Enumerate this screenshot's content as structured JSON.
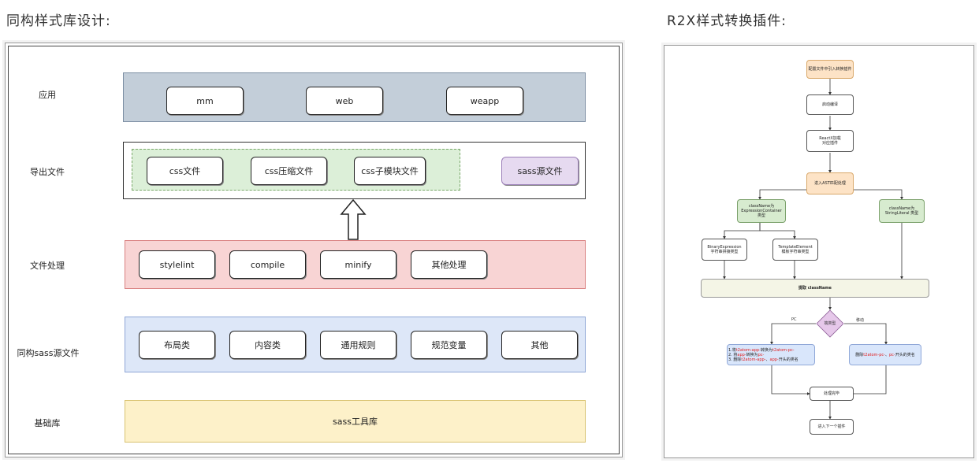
{
  "left": {
    "title": "同构样式库设计:",
    "rows": [
      {
        "label": "应用"
      },
      {
        "label": "导出文件"
      },
      {
        "label": "文件处理"
      },
      {
        "label": "同构sass源文件"
      },
      {
        "label": "基础库"
      }
    ],
    "app_items": [
      "mm",
      "web",
      "weapp"
    ],
    "export_items": [
      "css文件",
      "css压缩文件",
      "css子模块文件"
    ],
    "export_extra": "sass源文件",
    "process_items": [
      "stylelint",
      "compile",
      "minify",
      "其他处理"
    ],
    "source_items": [
      "布局类",
      "内容类",
      "通用规则",
      "规范变量",
      "其他"
    ],
    "base_item": "sass工具库",
    "colors": {
      "app": "#c3ced9",
      "export_group": "#dcefd8",
      "process": "#f8d4d4",
      "source": "#dde7f8",
      "base": "#fdf1c9",
      "sass": "#e6daf0"
    }
  },
  "right": {
    "title": "R2X样式转换插件:",
    "nodes": {
      "n1": "配置文件中引入转换插件",
      "n2": "启动编译",
      "n3a": "ReactX加载",
      "n3b": "对应插件",
      "n4": "进入AST匹配处理",
      "n5a": "className为",
      "n5b": "ExpressionContainer",
      "n5c": "类型",
      "n6a": "className为",
      "n6b": "StringLiteral 类型",
      "n7a": "BinaryExpression",
      "n7b": "字符串拼接类型",
      "n8a": "TemplateElement",
      "n8b": "模板字符串类型",
      "n9": "提取 className",
      "n10": "端类型",
      "pc": "PC",
      "mobile": "移动",
      "n11a_1": "1.将",
      "n11a_2": "t2atom-app-",
      "n11a_3": "转换为",
      "n11a_4": "t2atom-pc-",
      "n11b_1": "2. 将",
      "n11b_2": "app-",
      "n11b_3": "转换为",
      "n11b_4": "pc-",
      "n11c_1": "3. 删除",
      "n11c_2": "t2atom-app-",
      "n11c_3": "、",
      "n11c_4": "app-",
      "n11c_5": "开头的类名",
      "n12_1": "删除",
      "n12_2": "t2atom-pc-",
      "n12_3": "、",
      "n12_4": "pc-",
      "n12_5": "开头的类名",
      "n13": "处理完毕",
      "n14": "进入下一个插件"
    }
  }
}
